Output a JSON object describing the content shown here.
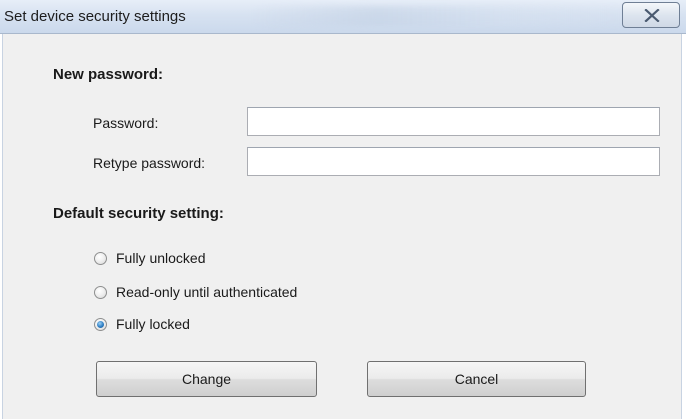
{
  "window": {
    "title": "Set device security settings",
    "close_icon": "close-x-icon"
  },
  "password_section": {
    "heading": "New password:",
    "password_label": "Password:",
    "password_value": "",
    "retype_label": "Retype password:",
    "retype_value": ""
  },
  "security_section": {
    "heading": "Default security setting:",
    "options": [
      {
        "label": "Fully unlocked",
        "checked": false
      },
      {
        "label": "Read-only until authenticated",
        "checked": false
      },
      {
        "label": "Fully locked",
        "checked": true
      }
    ]
  },
  "buttons": {
    "change_label": "Change",
    "cancel_label": "Cancel"
  },
  "colors": {
    "titlebar": "#d7e2f1",
    "client_background": "#f0f0f0",
    "radio_selected": "#2e7fc4"
  }
}
